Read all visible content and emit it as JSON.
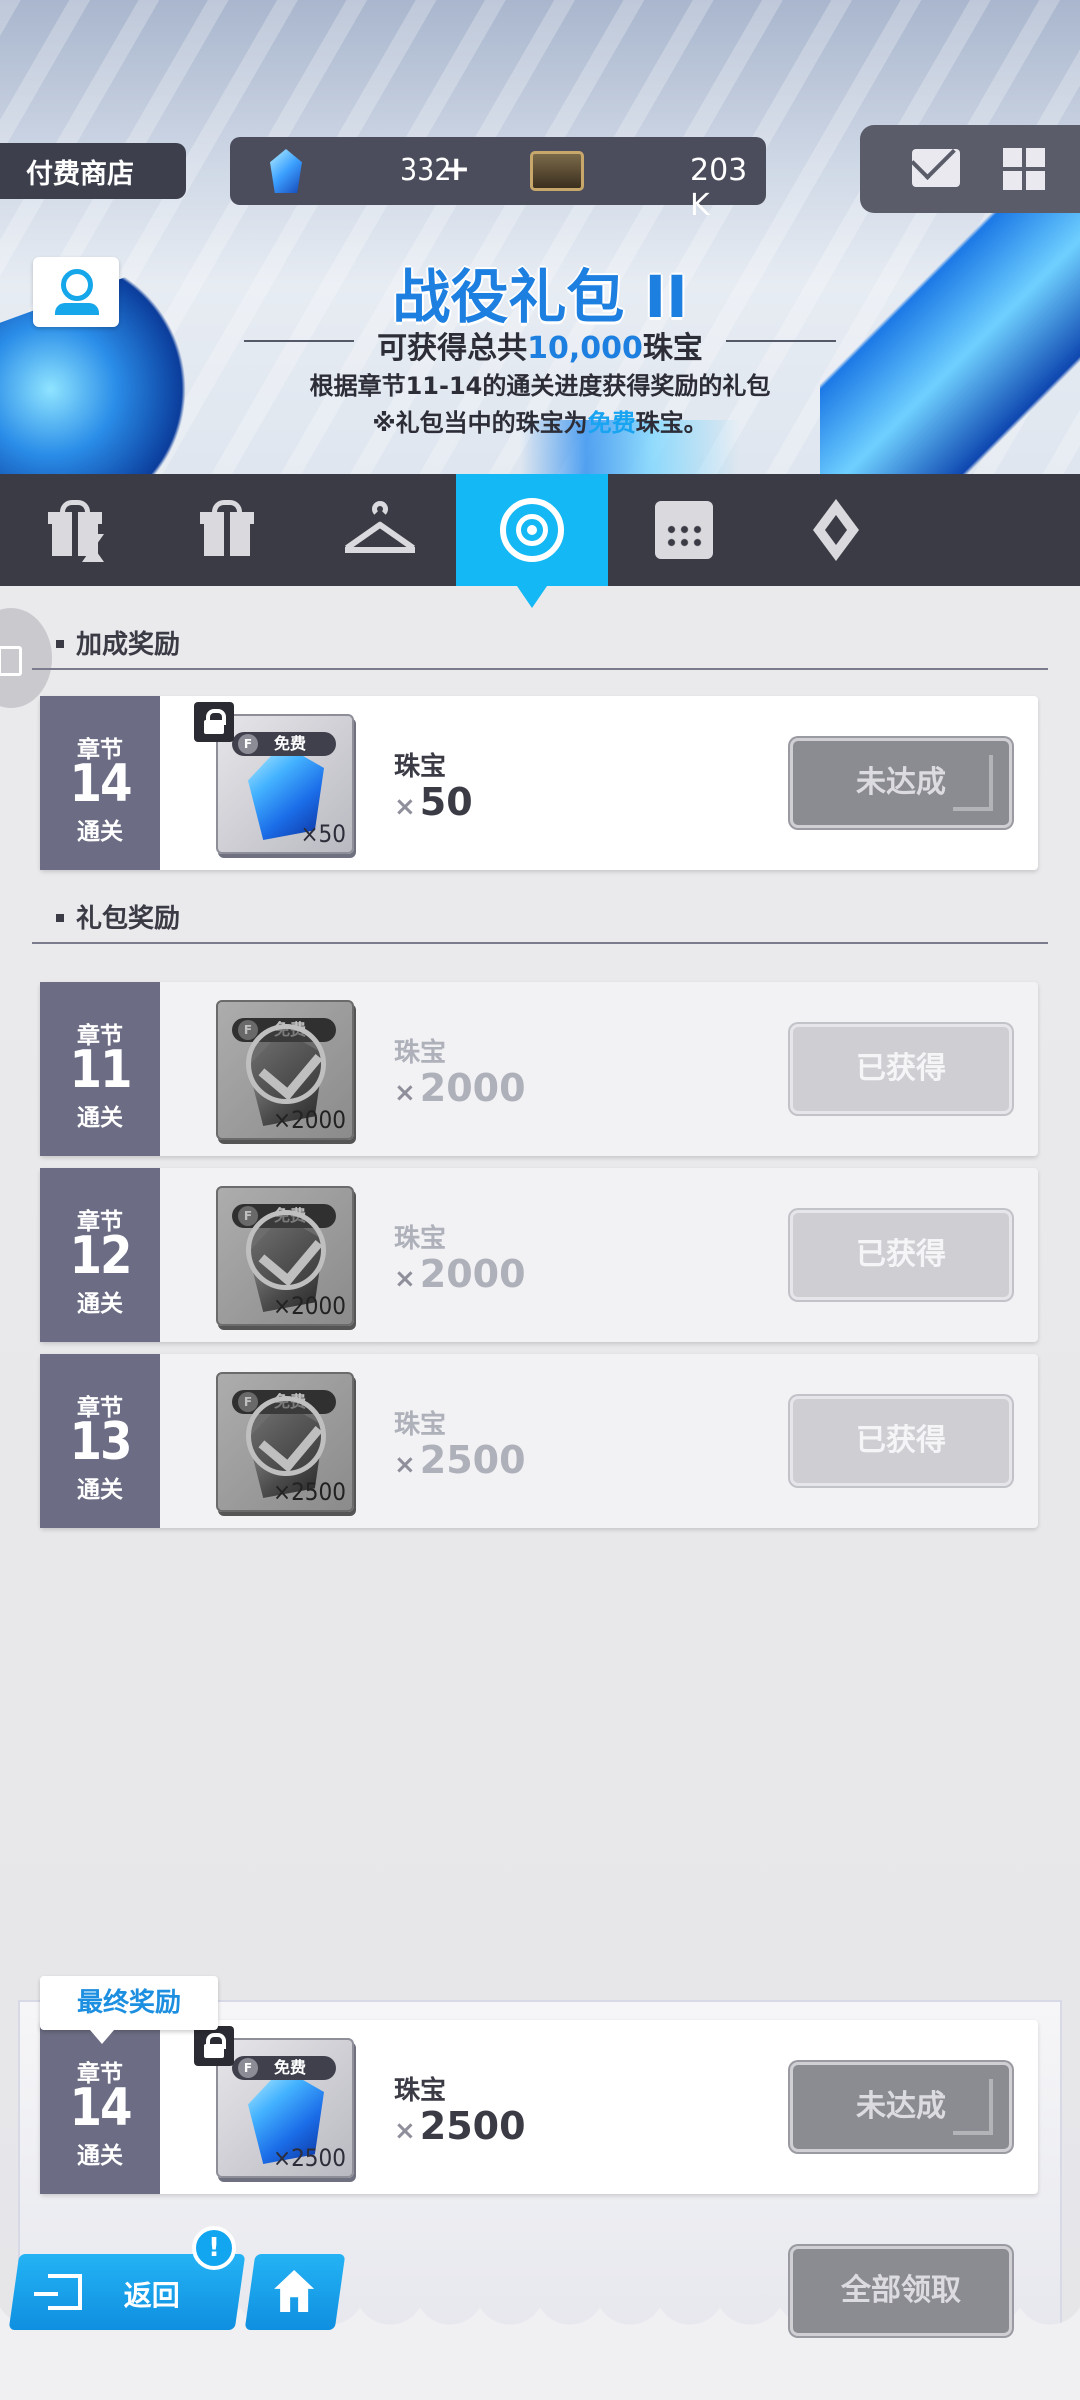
{
  "header": {
    "shop_label": "付费商店",
    "gem_count": "332",
    "gem_plus": "+",
    "ticket_count": "203 K"
  },
  "banner": {
    "title": "战役礼包 II",
    "sub1_prefix": "可获得总共",
    "sub1_amount": "10,000",
    "sub1_suffix": "珠宝",
    "sub2": "根据章节11-14的通关进度获得奖励的礼包",
    "sub3_prefix": "※礼包当中的珠宝为",
    "sub3_free": "免费",
    "sub3_suffix": "珠宝。"
  },
  "tabs": [
    {
      "icon": "gift-timer-icon",
      "active": false
    },
    {
      "icon": "gift-icon",
      "active": false
    },
    {
      "icon": "hanger-icon",
      "active": false
    },
    {
      "icon": "target-icon",
      "active": true
    },
    {
      "icon": "calendar-icon",
      "active": false
    },
    {
      "icon": "diamond-icon",
      "active": false
    }
  ],
  "sections": {
    "bonus": "加成奖励",
    "package": "礼包奖励"
  },
  "bonus_reward": {
    "chapter_top": "章节",
    "chapter_num": "14",
    "chapter_bottom": "通关",
    "free_tag": "免费",
    "item_qty": "×50",
    "name": "珠宝",
    "qty_x": "×",
    "qty": "50",
    "status": "未达成"
  },
  "package_rewards": [
    {
      "chapter_top": "章节",
      "chapter_num": "11",
      "chapter_bottom": "通关",
      "free_tag": "免费",
      "item_qty": "×2000",
      "name": "珠宝",
      "qty_x": "×",
      "qty": "2000",
      "status": "已获得"
    },
    {
      "chapter_top": "章节",
      "chapter_num": "12",
      "chapter_bottom": "通关",
      "free_tag": "免费",
      "item_qty": "×2000",
      "name": "珠宝",
      "qty_x": "×",
      "qty": "2000",
      "status": "已获得"
    },
    {
      "chapter_top": "章节",
      "chapter_num": "13",
      "chapter_bottom": "通关",
      "free_tag": "免费",
      "item_qty": "×2500",
      "name": "珠宝",
      "qty_x": "×",
      "qty": "2500",
      "status": "已获得"
    }
  ],
  "final_reward": {
    "tag": "最终奖励",
    "chapter_top": "章节",
    "chapter_num": "14",
    "chapter_bottom": "通关",
    "free_tag": "免费",
    "item_qty": "×2500",
    "name": "珠宝",
    "qty_x": "×",
    "qty": "2500",
    "status": "未达成"
  },
  "bottom": {
    "back_label": "返回",
    "notify": "!",
    "claim_all": "全部领取"
  },
  "colors": {
    "accent": "#13b8f4",
    "chapter_bg": "#6c6d84",
    "tabbar_bg": "#3a3b44"
  }
}
